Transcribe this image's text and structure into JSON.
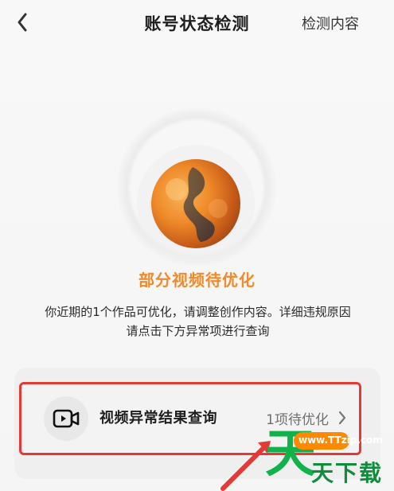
{
  "header": {
    "back_icon": "chevron-left-icon",
    "title": "账号状态检测",
    "right_action": "检测内容"
  },
  "status": {
    "title": "部分视频待优化",
    "description_line1": "你近期的1个作品可优化，请调整创作内容。详细违规原因",
    "description_line2": "请点击下方异常项进行查询",
    "accent_color": "#f08a2a"
  },
  "card": {
    "row_icon": "video-play-icon",
    "row_label": "视频异常结果查询",
    "row_count": "1项待优化",
    "chevron_icon": "chevron-right-icon",
    "highlight_color": "#e53935"
  },
  "watermark": {
    "url": "www.TTzip.com",
    "big_char": "天",
    "text": "天下载"
  }
}
